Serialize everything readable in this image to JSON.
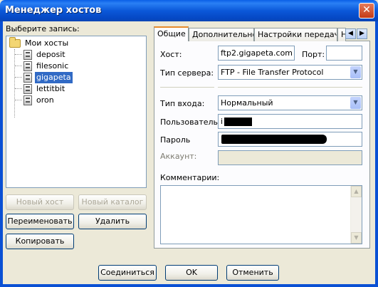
{
  "window": {
    "title": "Менеджер хостов",
    "close_glyph": "✕"
  },
  "left": {
    "select_label": "Выберите запись:",
    "tree": {
      "root": "Мои хосты",
      "items": [
        "deposit",
        "filesonic",
        "gigapeta",
        "lettitbit",
        "oron"
      ],
      "selected": "gigapeta"
    },
    "buttons": {
      "new_host": "Новый хост",
      "new_folder": "Новый каталог",
      "rename": "Переименовать",
      "delete": "Удалить",
      "copy": "Копировать"
    }
  },
  "tabs": {
    "items": [
      "Общие",
      "Дополнительно",
      "Настройки передачи",
      "Н"
    ],
    "active": "Общие",
    "scroll_left": "◀",
    "scroll_right": "▶"
  },
  "general": {
    "host_label": "Хост:",
    "host_value": "ftp2.gigapeta.com",
    "port_label": "Порт:",
    "port_value": "",
    "server_type_label": "Тип сервера:",
    "server_type_value": "FTP - File Transfer Protocol",
    "login_type_label": "Тип входа:",
    "login_type_value": "Нормальный",
    "user_label": "Пользователь:",
    "user_value": "i",
    "password_label": "Пароль",
    "account_label": "Аккаунт:",
    "comments_label": "Комментарии:",
    "combo_arrow": "▼",
    "scroll_up": "▲",
    "scroll_down": "▼"
  },
  "footer": {
    "connect": "Соединиться",
    "ok": "OK",
    "cancel": "Отменить"
  },
  "colors": {
    "titlebar": "#0b58d9",
    "selection": "#316ac5",
    "dialog_bg": "#ece9d8",
    "active_tab_accent": "#e68b2c"
  }
}
